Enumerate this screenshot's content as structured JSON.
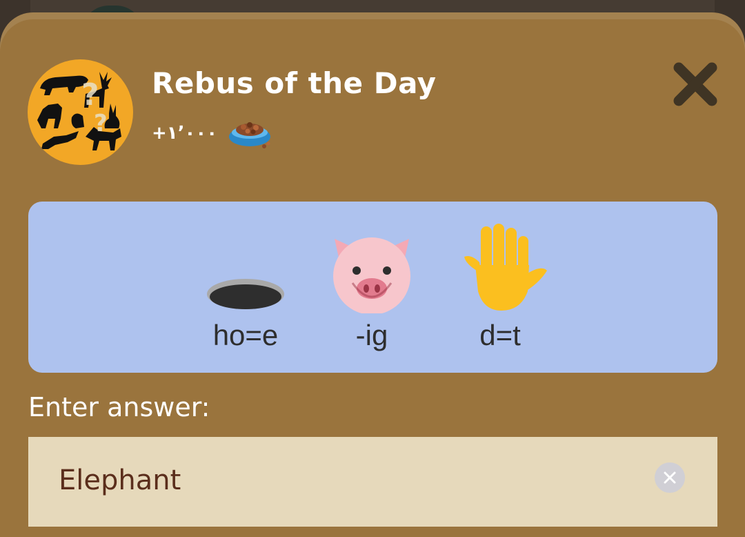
{
  "dialog": {
    "title": "Rebus of the Day",
    "reward_amount": "+١٬٠٠٠",
    "reward_icon": "pet-food-bowl-icon",
    "badge_icon": "animal-silhouettes-question-icon",
    "close_icon": "close-x-icon"
  },
  "puzzle": {
    "clues": [
      {
        "icon": "hole-icon",
        "text": "ho=e"
      },
      {
        "icon": "pig-face-icon",
        "text": "-ig"
      },
      {
        "icon": "raised-hand-icon",
        "text": "d=t"
      }
    ]
  },
  "answer": {
    "label": "Enter answer:",
    "value": "Elephant",
    "clear_icon": "clear-x-icon"
  },
  "colors": {
    "modal_background": "#9a743d",
    "puzzle_card": "#aec2ee",
    "input_background": "#e6d9bb",
    "input_text": "#5b2e1c",
    "badge_background": "#f2a726"
  }
}
